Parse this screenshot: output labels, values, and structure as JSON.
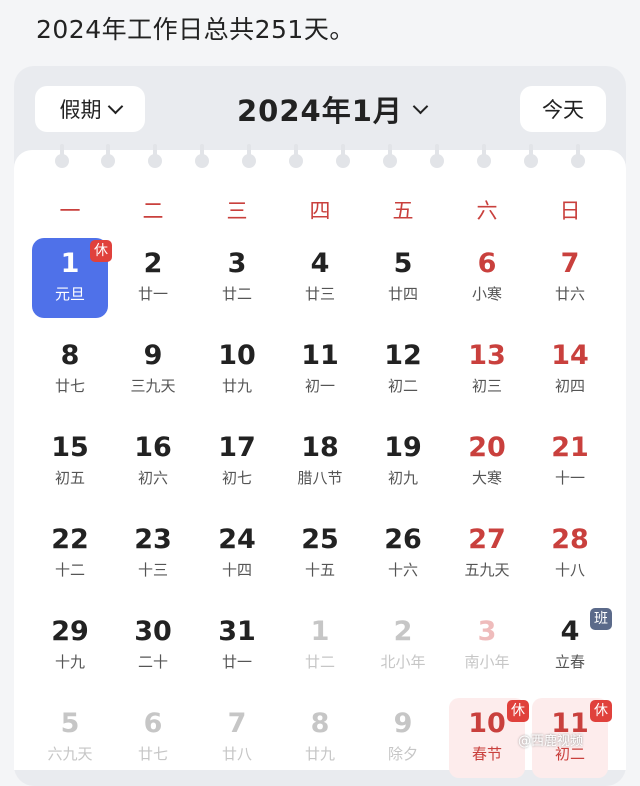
{
  "top_text": "2024年工作日总共251天。",
  "header": {
    "holiday_label": "假期",
    "month_label": "2024年1月",
    "today_label": "今天"
  },
  "weekdays": [
    "一",
    "二",
    "三",
    "四",
    "五",
    "六",
    "日"
  ],
  "weeks": [
    [
      {
        "day": "1",
        "lunar": "元旦",
        "state": "selected",
        "badge": "休"
      },
      {
        "day": "2",
        "lunar": "廿一"
      },
      {
        "day": "3",
        "lunar": "廿二"
      },
      {
        "day": "4",
        "lunar": "廿三"
      },
      {
        "day": "5",
        "lunar": "廿四"
      },
      {
        "day": "6",
        "lunar": "小寒"
      },
      {
        "day": "7",
        "lunar": "廿六"
      }
    ],
    [
      {
        "day": "8",
        "lunar": "廿七"
      },
      {
        "day": "9",
        "lunar": "三九天"
      },
      {
        "day": "10",
        "lunar": "廿九"
      },
      {
        "day": "11",
        "lunar": "初一"
      },
      {
        "day": "12",
        "lunar": "初二"
      },
      {
        "day": "13",
        "lunar": "初三"
      },
      {
        "day": "14",
        "lunar": "初四"
      }
    ],
    [
      {
        "day": "15",
        "lunar": "初五"
      },
      {
        "day": "16",
        "lunar": "初六"
      },
      {
        "day": "17",
        "lunar": "初七"
      },
      {
        "day": "18",
        "lunar": "腊八节"
      },
      {
        "day": "19",
        "lunar": "初九"
      },
      {
        "day": "20",
        "lunar": "大寒"
      },
      {
        "day": "21",
        "lunar": "十一"
      }
    ],
    [
      {
        "day": "22",
        "lunar": "十二"
      },
      {
        "day": "23",
        "lunar": "十三"
      },
      {
        "day": "24",
        "lunar": "十四"
      },
      {
        "day": "25",
        "lunar": "十五"
      },
      {
        "day": "26",
        "lunar": "十六"
      },
      {
        "day": "27",
        "lunar": "五九天"
      },
      {
        "day": "28",
        "lunar": "十八"
      }
    ],
    [
      {
        "day": "29",
        "lunar": "十九"
      },
      {
        "day": "30",
        "lunar": "二十"
      },
      {
        "day": "31",
        "lunar": "廿一"
      },
      {
        "day": "1",
        "lunar": "廿二",
        "state": "other"
      },
      {
        "day": "2",
        "lunar": "北小年",
        "state": "other"
      },
      {
        "day": "3",
        "lunar": "南小年",
        "state": "other"
      },
      {
        "day": "4",
        "lunar": "立春",
        "badge": "班",
        "weekday_override": true
      }
    ],
    [
      {
        "day": "5",
        "lunar": "六九天",
        "state": "other"
      },
      {
        "day": "6",
        "lunar": "廿七",
        "state": "other"
      },
      {
        "day": "7",
        "lunar": "廿八",
        "state": "other"
      },
      {
        "day": "8",
        "lunar": "廿九",
        "state": "other"
      },
      {
        "day": "9",
        "lunar": "除夕",
        "state": "other"
      },
      {
        "day": "10",
        "lunar": "春节",
        "state": "holiday",
        "badge": "休"
      },
      {
        "day": "11",
        "lunar": "初二",
        "state": "holiday",
        "badge": "休"
      }
    ]
  ],
  "badge_colors": {
    "rest": "#e0413c",
    "work": "#5b6a8a"
  },
  "accent_color": "#4f71e9",
  "watermark": "@西鹿视频"
}
